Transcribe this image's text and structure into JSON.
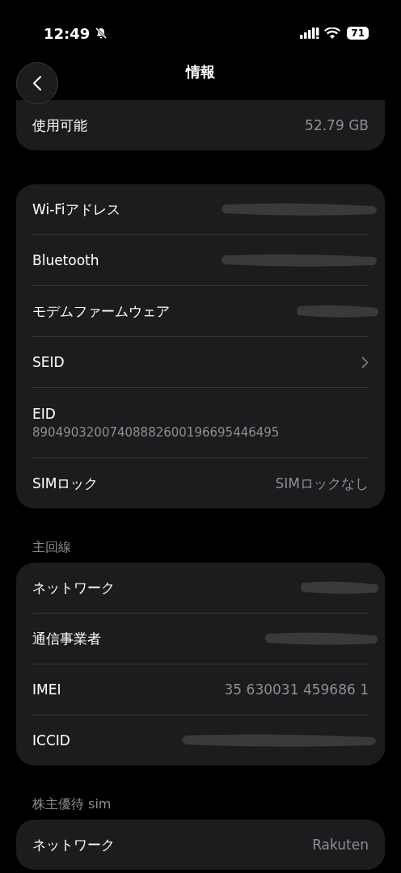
{
  "status_bar": {
    "time": "12:49",
    "battery": "71"
  },
  "nav": {
    "title": "情報"
  },
  "sections": [
    {
      "rows": [
        {
          "kind": "value",
          "label": "使用可能",
          "value": "52.79 GB"
        }
      ]
    },
    {
      "rows": [
        {
          "kind": "redacted",
          "label": "Wi-Fiアドレス"
        },
        {
          "kind": "redacted",
          "label": "Bluetooth"
        },
        {
          "kind": "redacted",
          "label": "モデムファームウェア"
        },
        {
          "kind": "chevron",
          "label": "SEID"
        },
        {
          "kind": "subtitle",
          "label": "EID",
          "value": "89049032007408882600196695446495"
        },
        {
          "kind": "value",
          "label": "SIMロック",
          "value": "SIMロックなし"
        }
      ]
    },
    {
      "header": "主回線",
      "rows": [
        {
          "kind": "redacted",
          "label": "ネットワーク"
        },
        {
          "kind": "redacted",
          "label": "通信事業者"
        },
        {
          "kind": "value",
          "label": "IMEI",
          "value": "35 630031 459686 1"
        },
        {
          "kind": "redacted",
          "label": "ICCID"
        }
      ]
    },
    {
      "header": "株主優待 sim",
      "rows": [
        {
          "kind": "value",
          "label": "ネットワーク",
          "value": "Rakuten"
        }
      ]
    }
  ]
}
